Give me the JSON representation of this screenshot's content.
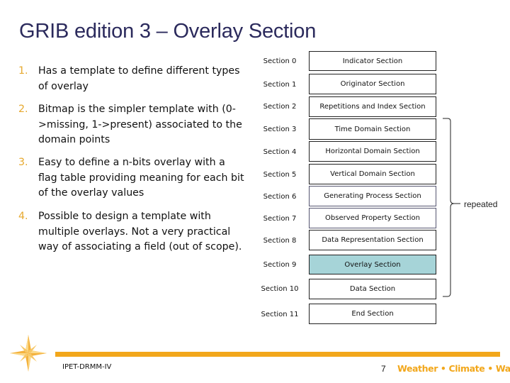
{
  "slide": {
    "title": "GRIB edition 3 – Overlay Section",
    "bullets": [
      {
        "num": "1.",
        "text": "Has a template to define different types of overlay"
      },
      {
        "num": "2.",
        "text": "Bitmap is the simpler template with (0->missing, 1->present) associated to the domain points"
      },
      {
        "num": "3.",
        "text": "Easy to define a n-bits overlay with a flag table providing meaning for each bit of the overlay values"
      },
      {
        "num": "4.",
        "text": "Possible to design a template with multiple overlays. Not a very practical way of associating a field (out of scope)."
      }
    ],
    "sections": [
      {
        "label": "Section 0",
        "name": "Indicator Section",
        "highlight": false
      },
      {
        "label": "Section 1",
        "name": "Originator Section",
        "highlight": false
      },
      {
        "label": "Section 2",
        "name": "Repetitions and Index Section",
        "highlight": false
      },
      {
        "label": "Section 3",
        "name": "Time Domain Section",
        "highlight": false
      },
      {
        "label": "Section 4",
        "name": "Horizontal Domain Section",
        "highlight": false
      },
      {
        "label": "Section 5",
        "name": "Vertical Domain Section",
        "highlight": false
      },
      {
        "label": "Section 6",
        "name": "Generating Process Section",
        "highlight": false
      },
      {
        "label": "Section 7",
        "name": "Observed Property Section",
        "highlight": false
      },
      {
        "label": "Section 8",
        "name": "Data Representation Section",
        "highlight": false
      },
      {
        "label": "Section 9",
        "name": "Overlay Section",
        "highlight": true
      },
      {
        "label": "Section 10",
        "name": "Data Section",
        "highlight": false
      },
      {
        "label": "Section 11",
        "name": "End Section",
        "highlight": false
      }
    ],
    "repeated_label": "repeated",
    "colors": {
      "title": "#2b2a5c",
      "accent": "#f2a71b",
      "highlight": "#a6d4d8"
    }
  },
  "footer": {
    "left_text": "IPET-DRMM-IV",
    "page_number": "7",
    "tagline": "Weather • Climate • Water",
    "logo_icon": "compass-star-icon"
  }
}
